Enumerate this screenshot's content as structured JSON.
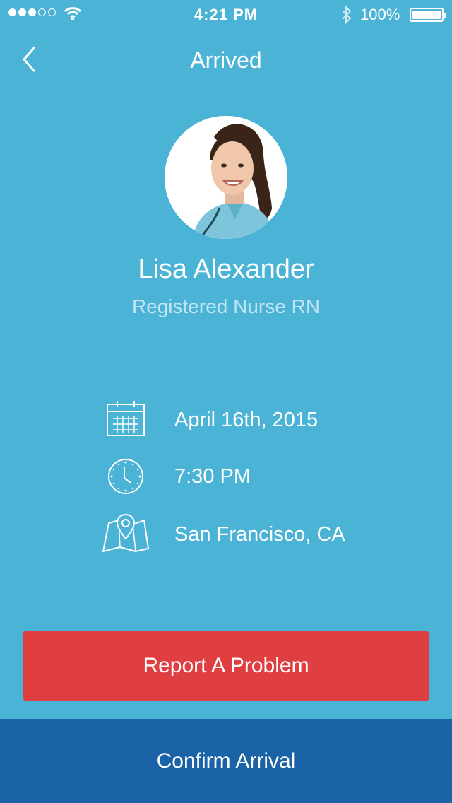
{
  "status_bar": {
    "time": "4:21 PM",
    "battery_percent": "100%",
    "signal_bars": 3,
    "signal_total": 5
  },
  "nav": {
    "title": "Arrived",
    "back_icon": "chevron-left-icon"
  },
  "profile": {
    "name": "Lisa Alexander",
    "role": "Registered Nurse RN"
  },
  "details": [
    {
      "icon": "calendar-icon",
      "text": "April 16th, 2015"
    },
    {
      "icon": "clock-icon",
      "text": "7:30 PM"
    },
    {
      "icon": "map-pin-icon",
      "text": "San Francisco, CA"
    }
  ],
  "actions": {
    "report_label": "Report A Problem",
    "confirm_label": "Confirm Arrival"
  },
  "colors": {
    "background": "#4bb3d6",
    "danger": "#e03f42",
    "primary": "#1a63a6",
    "subtitle": "#bfe4f2"
  }
}
